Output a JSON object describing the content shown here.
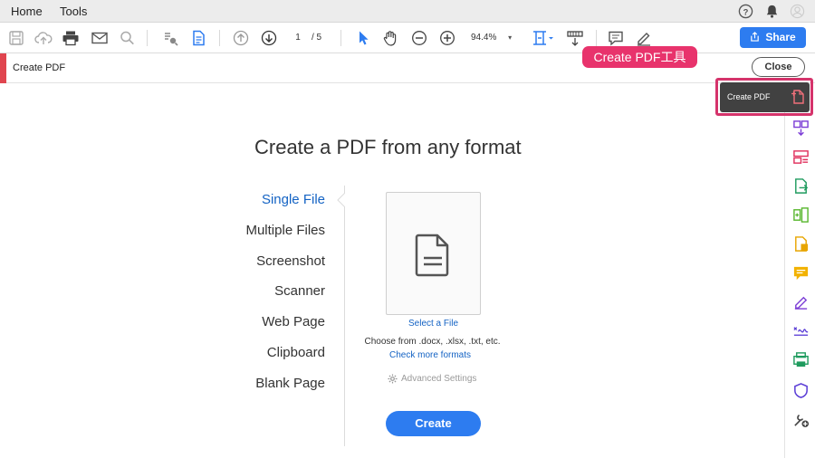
{
  "menubar": {
    "items": [
      "Home",
      "Tools"
    ],
    "icons": [
      "help-icon",
      "bell-icon",
      "account-icon"
    ]
  },
  "toolbar": {
    "current_page": "1",
    "page_total": "/ 5",
    "zoom": "94.4%",
    "share_label": "Share"
  },
  "tool_header": {
    "title": "Create PDF",
    "close_label": "Close"
  },
  "annotation": {
    "label": "Create PDF工具"
  },
  "tooltip": {
    "label": "Create PDF"
  },
  "main": {
    "heading": "Create a PDF from any format",
    "options": [
      "Single File",
      "Multiple Files",
      "Screenshot",
      "Scanner",
      "Web Page",
      "Clipboard",
      "Blank Page"
    ],
    "active_option": "Single File",
    "select_file": "Select a File",
    "choose_from": "Choose from .docx, .xlsx, .txt, etc.",
    "check_more": "Check more formats",
    "advanced": "Advanced Settings",
    "create_label": "Create"
  },
  "colors": {
    "accent": "#2d7cf0",
    "link": "#1463c4",
    "annotation": "#e8336c",
    "tool_red": "#e0454f"
  }
}
